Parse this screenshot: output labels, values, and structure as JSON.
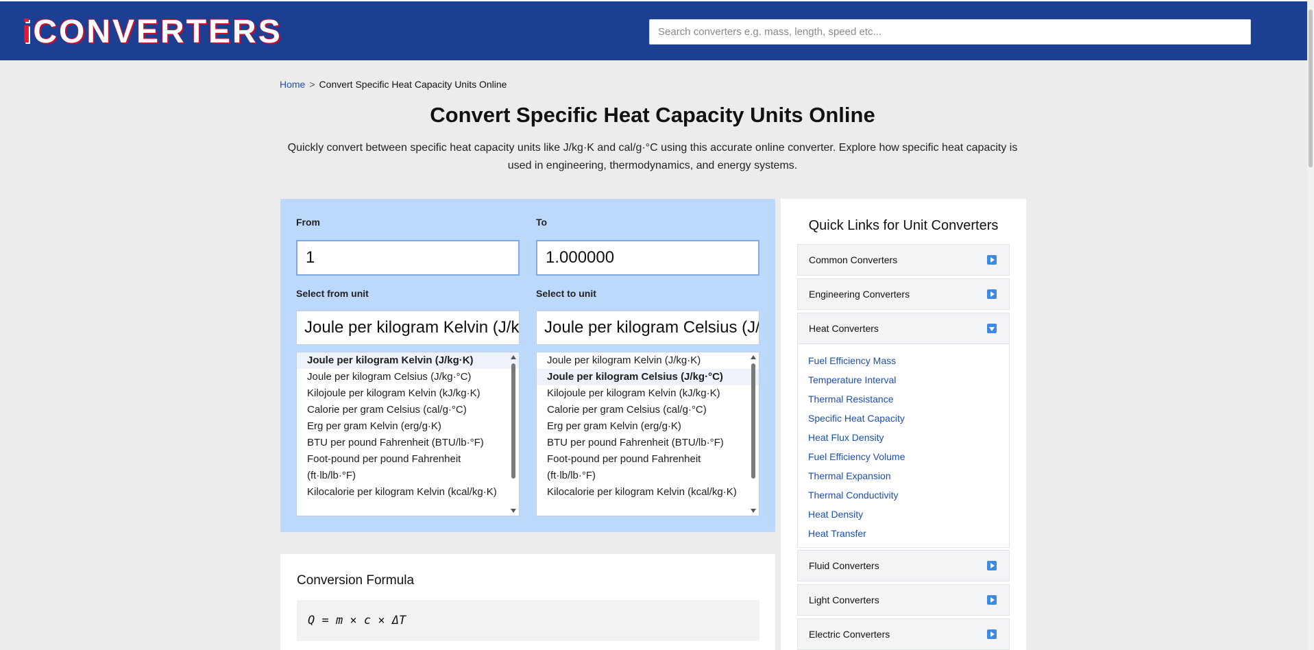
{
  "header": {
    "logo_text": "CONVERTERS",
    "search_placeholder": "Search converters e.g. mass, length, speed etc..."
  },
  "breadcrumb": {
    "home": "Home",
    "separator": ">",
    "current": "Convert Specific Heat Capacity Units Online"
  },
  "page": {
    "title": "Convert Specific Heat Capacity Units Online",
    "intro": "Quickly convert between specific heat capacity units like J/kg·K and cal/g·°C using this accurate online converter. Explore how specific heat capacity is used in engineering, thermodynamics, and energy systems."
  },
  "converter": {
    "from_label": "From",
    "to_label": "To",
    "from_value": "1",
    "to_value": "1.000000",
    "select_from_label": "Select from unit",
    "select_to_label": "Select to unit",
    "from_unit_display": "Joule per kilogram Kelvin (J/kg·K)",
    "to_unit_display": "Joule per kilogram Celsius (J/kg·°C)",
    "units": [
      "Joule per kilogram Kelvin (J/kg·K)",
      "Joule per kilogram Celsius (J/kg·°C)",
      "Kilojoule per kilogram Kelvin (kJ/kg·K)",
      "Calorie per gram Celsius (cal/g·°C)",
      "Erg per gram Kelvin (erg/g·K)",
      "BTU per pound Fahrenheit (BTU/lb·°F)",
      "Foot-pound per pound Fahrenheit (ft·lb/lb·°F)",
      "Kilocalorie per kilogram Kelvin (kcal/kg·K)"
    ],
    "from_selected_index": 0,
    "to_selected_index": 1
  },
  "formula": {
    "heading": "Conversion Formula",
    "expression": "Q = m × c × ΔT"
  },
  "sidebar": {
    "title": "Quick Links for Unit Converters",
    "groups": [
      {
        "label": "Common Converters",
        "expanded": false
      },
      {
        "label": "Engineering Converters",
        "expanded": false
      },
      {
        "label": "Heat Converters",
        "expanded": true,
        "links": [
          "Fuel Efficiency Mass",
          "Temperature Interval",
          "Thermal Resistance",
          "Specific Heat Capacity",
          "Heat Flux Density",
          "Fuel Efficiency Volume",
          "Thermal Expansion",
          "Thermal Conductivity",
          "Heat Density",
          "Heat Transfer"
        ]
      },
      {
        "label": "Fluid Converters",
        "expanded": false
      },
      {
        "label": "Light Converters",
        "expanded": false
      },
      {
        "label": "Electric Converters",
        "expanded": false
      }
    ]
  },
  "colors": {
    "header_bg": "#1c3f94",
    "converter_bg": "#bcd8fb",
    "link": "#1c4fb0",
    "accent_arrow": "#3f8ae0",
    "logo_red": "#e21b2f"
  }
}
